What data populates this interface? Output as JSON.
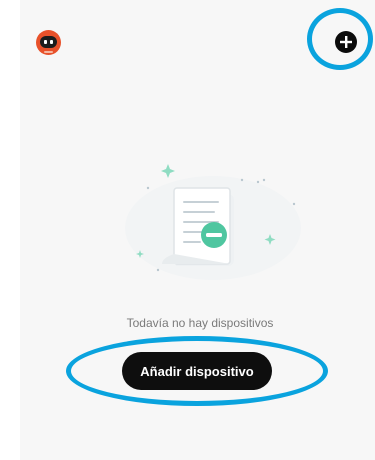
{
  "header": {
    "avatar_icon": "robot-avatar-icon",
    "add_icon": "plus-circle-icon"
  },
  "empty_state": {
    "illustration_icon": "document-minus-icon",
    "message": "Todavía no hay dispositivos",
    "add_device_label": "Añadir dispositivo"
  },
  "colors": {
    "highlight": "#0aa3de",
    "button_bg": "#0e0e0e",
    "accent_green": "#4fc6a0",
    "avatar_orange": "#e8512a"
  }
}
